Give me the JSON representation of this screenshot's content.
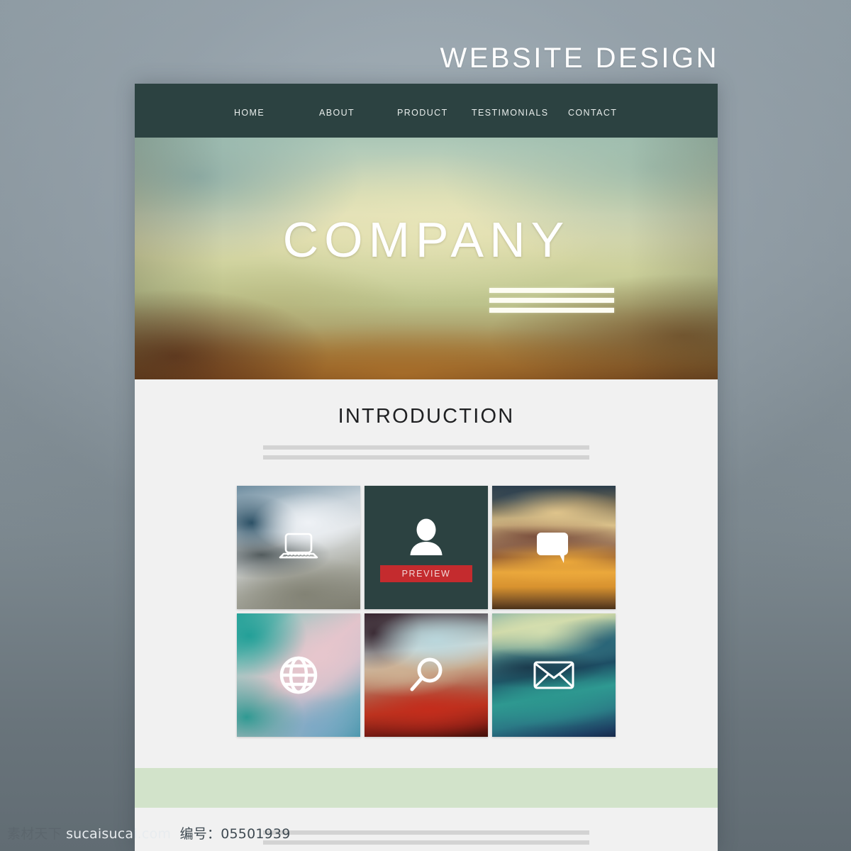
{
  "poster": {
    "headline": "WEBSITE DESIGN",
    "backdrop_color": "#8e9aa2"
  },
  "navbar": {
    "background_color": "#2c4241",
    "items": [
      {
        "label": "HOME"
      },
      {
        "label": "ABOUT"
      },
      {
        "label": "PRODUCT"
      },
      {
        "label": "TESTIMONIALS"
      },
      {
        "label": "CONTACT"
      }
    ]
  },
  "hero": {
    "title": "COMPANY",
    "bar_count": 3,
    "bar_color": "#fdfdf3"
  },
  "introduction": {
    "title": "INTRODUCTION",
    "divider_color": "#d3d3d3",
    "divider_count": 2
  },
  "tiles": [
    {
      "icon": "laptop-icon",
      "label": ""
    },
    {
      "icon": "person-icon",
      "label": "",
      "button": "PREVIEW",
      "button_color": "#c42b2e",
      "background_color": "#2c4241"
    },
    {
      "icon": "chat-bubble-icon",
      "label": ""
    },
    {
      "icon": "globe-icon",
      "label": ""
    },
    {
      "icon": "search-icon",
      "label": ""
    },
    {
      "icon": "envelope-icon",
      "label": ""
    }
  ],
  "green_band": {
    "color": "#d2e3ca"
  },
  "footer": {
    "divider_color": "#d3d3d3",
    "divider_count": 2
  },
  "watermark": {
    "prefix": "素材天下",
    "site": "sucaisucai.com",
    "label": "编号：",
    "code": "05501939"
  }
}
